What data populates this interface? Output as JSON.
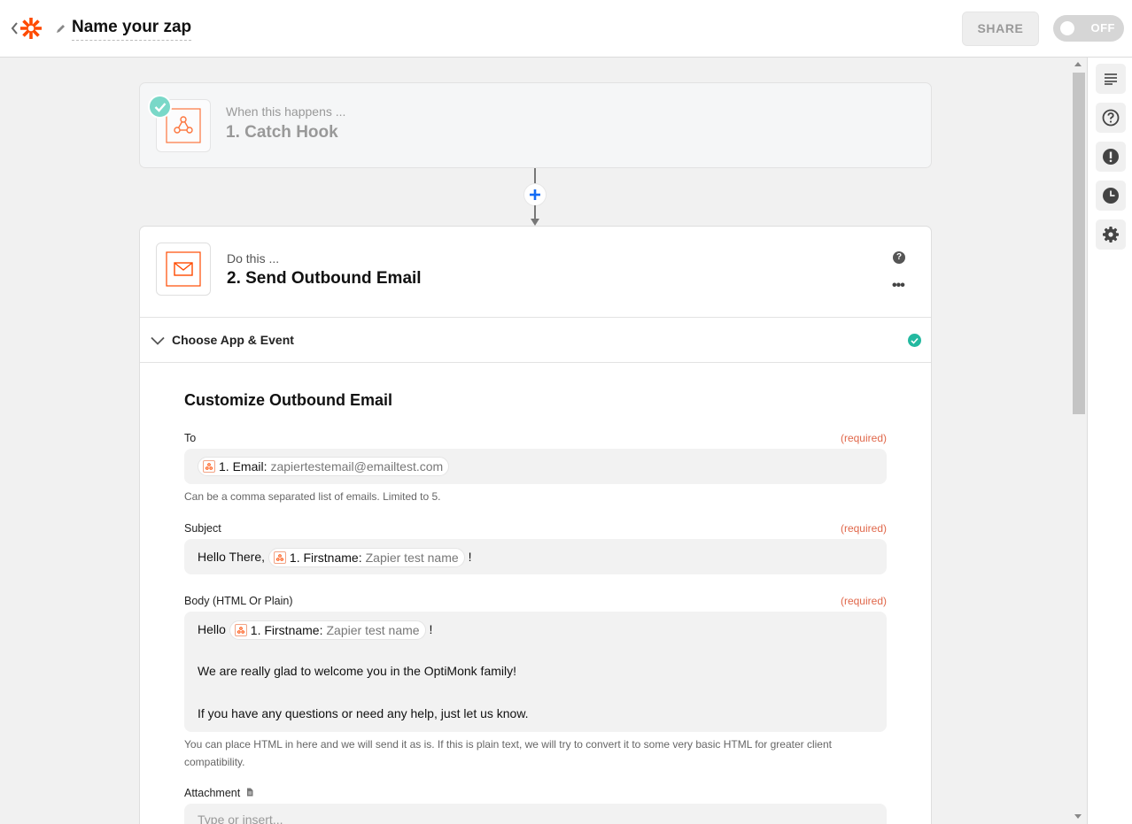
{
  "header": {
    "zap_name": "Name your zap",
    "share_label": "SHARE",
    "toggle_label": "OFF"
  },
  "colors": {
    "brand_orange": "#ff4a00",
    "success_green": "#23b9a0",
    "required_red": "#e0674a"
  },
  "step1": {
    "subtitle": "When this happens ...",
    "title": "1. Catch Hook"
  },
  "step2": {
    "subtitle": "Do this ...",
    "title": "2. Send Outbound Email",
    "section_title": "Choose App & Event",
    "customize_title": "Customize Outbound Email",
    "fields": {
      "to": {
        "label": "To",
        "required": "(required)",
        "pill_key": "1. Email:",
        "pill_value": "zapiertestemail@emailtest.com",
        "help": "Can be a comma separated list of emails. Limited to 5."
      },
      "subject": {
        "label": "Subject",
        "required": "(required)",
        "prefix": "Hello There,",
        "pill_key": "1. Firstname:",
        "pill_value": "Zapier test name",
        "suffix": "!"
      },
      "body": {
        "label": "Body (HTML Or Plain)",
        "required": "(required)",
        "prefix": "Hello",
        "pill_key": "1. Firstname:",
        "pill_value": "Zapier test name",
        "suffix": "!",
        "line2": "We are really glad to welcome you in the OptiMonk family!",
        "line3": "If you have any questions or need any help, just let us know.",
        "help": "You can place HTML in here and we will send it as is. If this is plain text, we will try to convert it to some very basic HTML for greater client compatibility."
      },
      "attachment": {
        "label": "Attachment",
        "placeholder": "Type or insert..."
      }
    }
  },
  "sidebar_icons": [
    "details-icon",
    "help-icon",
    "alert-icon",
    "history-icon",
    "settings-icon"
  ]
}
